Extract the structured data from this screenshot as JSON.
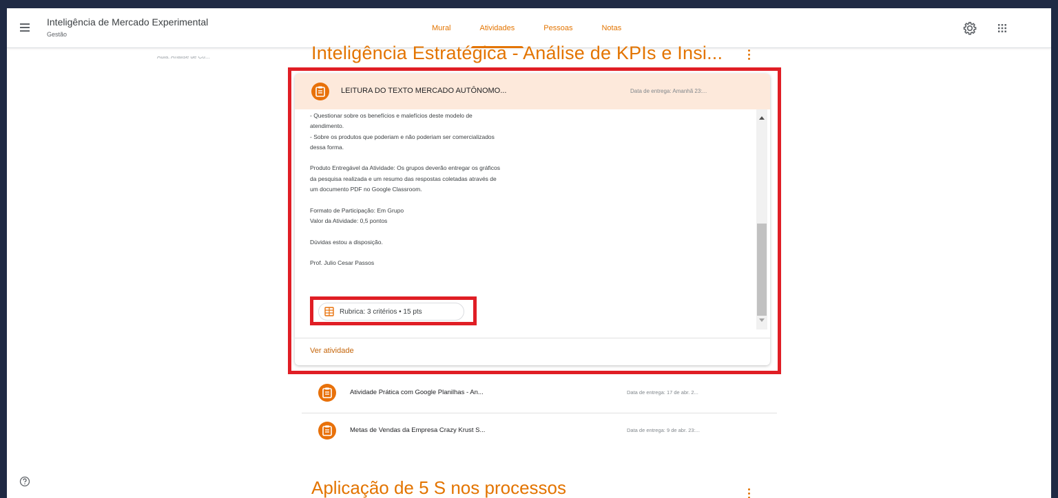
{
  "header": {
    "class_title": "Inteligência de Mercado Experimental",
    "class_subtitle": "Gestão",
    "tabs": [
      {
        "label": "Mural"
      },
      {
        "label": "Atividades"
      },
      {
        "label": "Pessoas"
      },
      {
        "label": "Notas"
      }
    ],
    "active_tab": "Atividades"
  },
  "sidebar": {
    "truncated_item": "Aula: Análise de Co..."
  },
  "topic": {
    "title": "Inteligência Estratégica - Análise de KPIs e Insi..."
  },
  "expanded_assignment": {
    "title": "LEITURA DO TEXTO MERCADO AUTÔNOMO...",
    "due": "Data de entrega: Amanhã 23:...",
    "description_lines": [
      "- Questionar sobre os benefícios e malefícios deste modelo de",
      "atendimento.",
      "- Sobre os produtos que poderiam e não poderiam ser comercializados",
      "dessa forma.",
      "",
      "Produto Entregável da Atividade: Os grupos deverão entregar os gráficos",
      "da pesquisa realizada e um resumo das respostas coletadas através de",
      "um documento PDF no Google Classroom.",
      "",
      "Formato de Participação: Em Grupo",
      "Valor da Atividade: 0,5 pontos",
      "",
      "Dúvidas estou a disposição.",
      "",
      "Prof. Julio Cesar Passos"
    ],
    "rubric": "Rubrica: 3 critérios • 15 pts",
    "view_link": "Ver atividade"
  },
  "assignments": [
    {
      "title": "Atividade Prática com Google Planilhas - An...",
      "due": "Data de entrega: 17 de abr. 2..."
    },
    {
      "title": "Metas de Vendas da Empresa Crazy Krust S...",
      "due": "Data de entrega: 9 de abr. 23:..."
    }
  ],
  "next_topic": {
    "title": "Aplicação de 5 S nos processos"
  },
  "colors": {
    "accent": "#e37400",
    "highlight": "#e01e25",
    "icon_bg": "#e8710a",
    "card_head_bg": "#fde9db"
  }
}
